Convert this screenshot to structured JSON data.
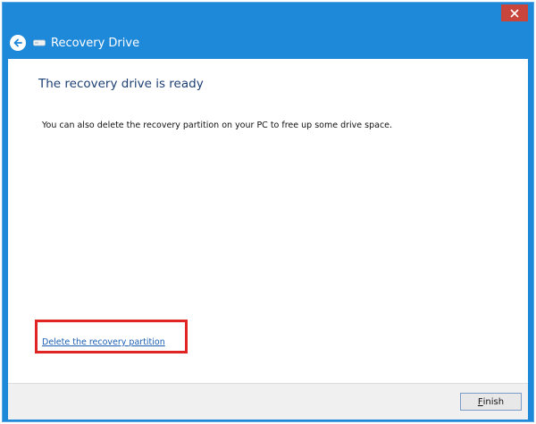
{
  "window": {
    "title": "Recovery Drive"
  },
  "icons": {
    "back": "back-arrow-icon",
    "app": "drive-icon",
    "close": "close-icon"
  },
  "content": {
    "heading": "The recovery drive is ready",
    "description": "You can also delete the recovery partition on your PC to free up some drive space.",
    "delete_link": "Delete the recovery partition"
  },
  "footer": {
    "finish_mnemonic": "F",
    "finish_rest": "inish"
  },
  "colors": {
    "titlebar": "#1e88d9",
    "close_button": "#c7453a",
    "heading": "#1d3f73",
    "link": "#1a5fb4",
    "highlight": "#e02424"
  }
}
